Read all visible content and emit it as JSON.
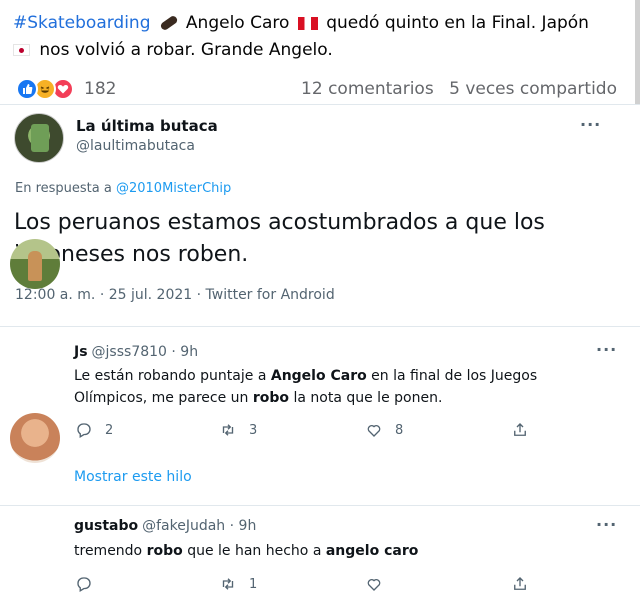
{
  "facebook": {
    "hashtag": "#Skateboarding",
    "text_part1": "Angelo Caro",
    "text_part2": "quedó quinto en la Final. Japón",
    "text_part3": "nos volvió a robar. Grande Angelo.",
    "reaction_count": "182",
    "comments": "12 comentarios",
    "shares": "5 veces compartido"
  },
  "main_tweet": {
    "name": "La última butaca",
    "handle": "@laultimabutaca",
    "reply_prefix": "En respuesta a",
    "reply_mention": "@2010MisterChip",
    "text": "Los peruanos estamos acostumbrados a que los japoneses nos roben.",
    "meta": "12:00 a. m. · 25 jul. 2021 · Twitter for Android",
    "more_glyph": "···"
  },
  "replies": [
    {
      "name": "Js",
      "handle_time": "@jsss7810 · 9h",
      "text_a": "Le están robando puntaje a ",
      "bold_a": "Angelo Caro",
      "text_b": " en la final de los Juegos Olímpicos, me parece un ",
      "bold_b": "robo",
      "text_c": " la nota que le ponen.",
      "replies_count": "2",
      "retweets_count": "3",
      "likes_count": "8"
    },
    {
      "name": "gustabo",
      "handle_time": "@fakeJudah · 9h",
      "text_a": "tremendo ",
      "bold_a": "robo",
      "text_b": " que le han hecho a ",
      "bold_b": "angelo caro",
      "replies_count": "",
      "retweets_count": "1",
      "likes_count": ""
    }
  ],
  "show_thread": "Mostrar este hilo",
  "colors": {
    "link": "#1d9bf0",
    "fb_hashtag": "#216fdb",
    "muted": "#536471"
  }
}
